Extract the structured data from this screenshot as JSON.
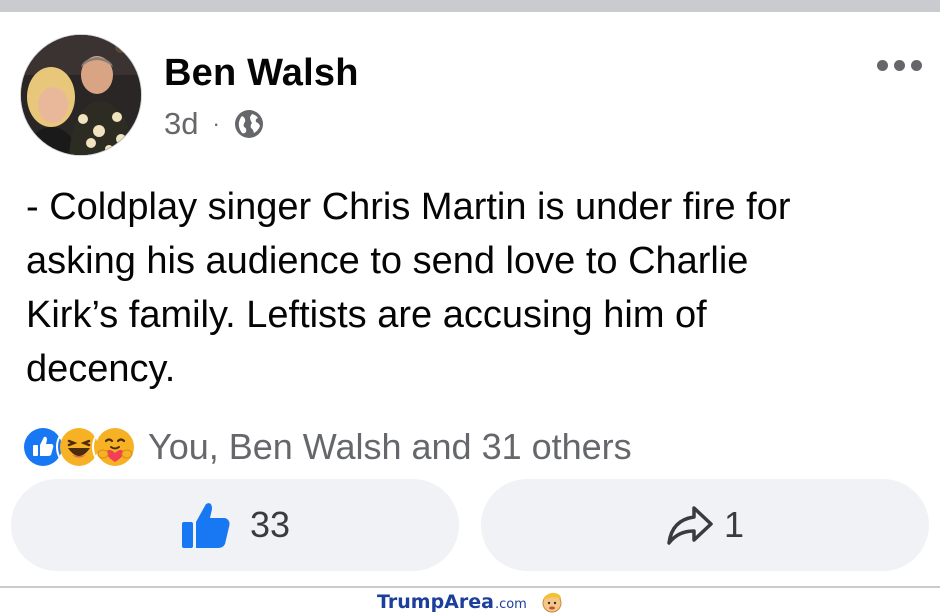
{
  "post": {
    "author": "Ben Walsh",
    "time": "3d",
    "separator": "·",
    "audience_icon": "globe-icon",
    "menu_icon": "more-options-icon",
    "text": "- Coldplay singer Chris Martin is under fire for\nasking his audience to send love to Charlie\nKirk’s family. Leftists are accusing him of\ndecency."
  },
  "reactions": {
    "icons": [
      "like-reaction-icon",
      "haha-reaction-icon",
      "care-reaction-icon"
    ],
    "summary": "You, Ben Walsh and 31 others"
  },
  "actions": {
    "like_count": "33",
    "share_count": "1"
  },
  "watermark": {
    "brand": "TrumpArea",
    "tld": ".com"
  },
  "colors": {
    "facebook_blue": "#1877f2",
    "secondary_text": "#65676b",
    "button_bg": "#f0f2f5",
    "watermark_blue": "#1b3f9a"
  }
}
